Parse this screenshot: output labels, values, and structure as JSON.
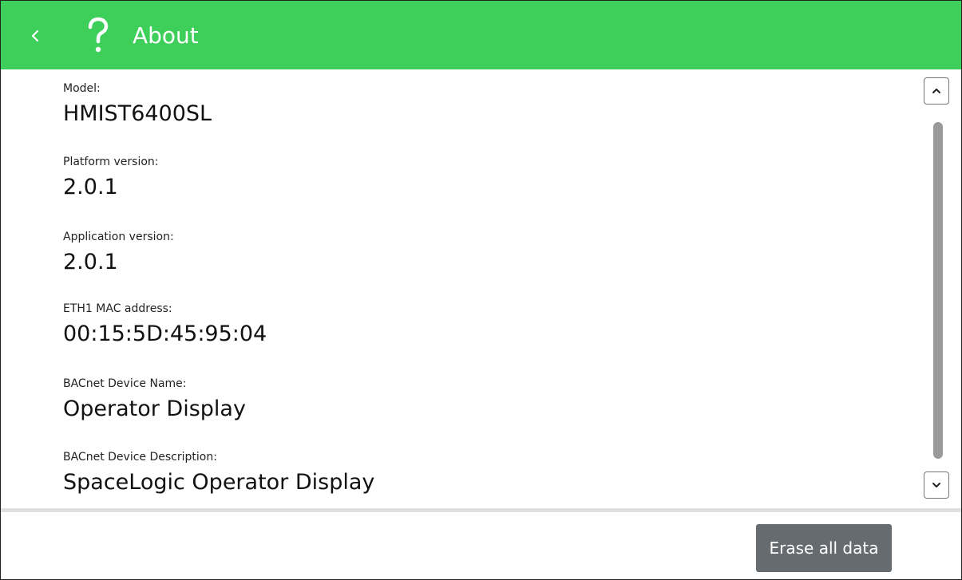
{
  "header": {
    "title": "About",
    "background_color": "#3ecf5a",
    "back_icon": "chevron-left-icon",
    "help_icon": "question-mark-icon"
  },
  "fields": [
    {
      "label": "Model:",
      "value": "HMIST6400SL"
    },
    {
      "label": "Platform version:",
      "value": "2.0.1"
    },
    {
      "label": "Application version:",
      "value": "2.0.1"
    },
    {
      "label": "ETH1 MAC address:",
      "value": "00:15:5D:45:95:04"
    },
    {
      "label": "BACnet Device Name:",
      "value": "Operator Display"
    },
    {
      "label": "BACnet Device Description:",
      "value": "SpaceLogic Operator Display"
    }
  ],
  "scrollbar": {
    "up_icon": "chevron-up-icon",
    "down_icon": "chevron-down-icon"
  },
  "actions": {
    "erase_label": "Erase all data",
    "erase_color": "#666b70"
  }
}
